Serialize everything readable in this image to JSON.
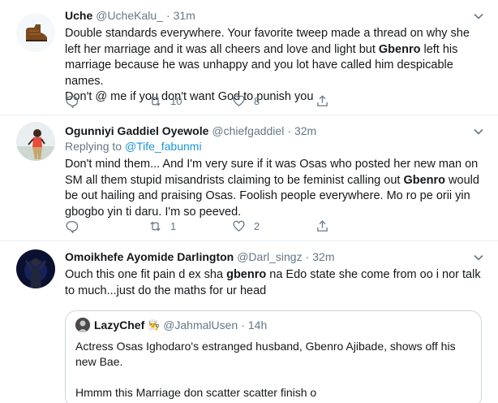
{
  "tweets": [
    {
      "name": "Uche",
      "handle": "@UcheKalu_",
      "separator": "·",
      "time": "31m",
      "text_parts": [
        "Double standards everywhere. Your favorite tweep made a thread on why she left her marriage and it was all cheers and love and light but ",
        "Gbenro",
        " left his marriage because he was unhappy and you lot have called him despicable names.",
        "Don't @ me if you don't want God to punish you"
      ],
      "reply_count": "",
      "retweet_count": "10",
      "like_count": "8"
    },
    {
      "name": "Ogunniyi Gaddiel Oyewole",
      "handle": "@chiefgaddiel",
      "separator": "·",
      "time": "32m",
      "replying_prefix": "Replying to ",
      "replying_handle": "@Tife_fabunmi",
      "text_parts": [
        "Don't mind them... And I'm very sure if it was Osas who posted her new man on SM all them stupid misandrists claiming to be feminist calling out ",
        "Gbenro",
        " would be out hailing and praising Osas.  Foolish people everywhere. Mo ro pe orii yin gbogbo yin ti daru.  I'm so peeved."
      ],
      "reply_count": "",
      "retweet_count": "1",
      "like_count": "2"
    },
    {
      "name": "Omoikhefe Ayomide Darlington",
      "handle": "@Darl_singz",
      "separator": "·",
      "time": "32m",
      "text_parts": [
        "Ouch this one fit pain d ex sha ",
        "gbenro",
        " na Edo state she come from oo i nor talk to much...just do the maths for ur head"
      ],
      "quote": {
        "name": "LazyChef",
        "emoji": "👨‍🍳",
        "handle": "@JahmalUsen",
        "separator": "·",
        "time": "14h",
        "line1": "Actress Osas Ighodaro's estranged husband, Gbenro Ajibade, shows off his new Bae.",
        "line2": "Hmmm this Marriage don scatter scatter finish o"
      }
    }
  ],
  "icons": {
    "reply": "reply-icon",
    "retweet": "retweet-icon",
    "like": "heart-icon",
    "share": "share-icon",
    "caret": "chevron-down-icon"
  },
  "colors": {
    "text": "#14171a",
    "muted": "#657786",
    "link": "#1b95e0",
    "border": "#e6ecf0"
  }
}
